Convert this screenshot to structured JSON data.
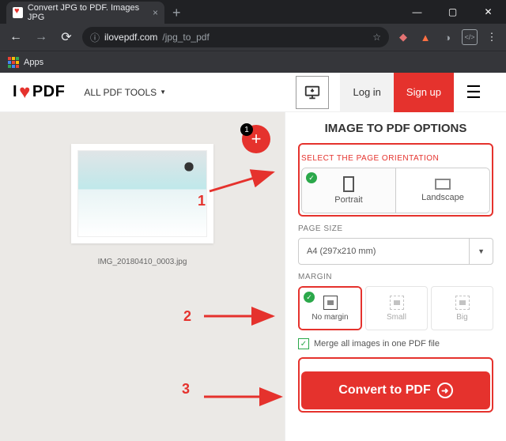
{
  "browser": {
    "tab_title": "Convert JPG to PDF. Images JPG",
    "url_domain": "ilovepdf.com",
    "url_path": "/jpg_to_pdf",
    "bookmarks_label": "Apps"
  },
  "header": {
    "logo_left": "I",
    "logo_right": "PDF",
    "nav_label": "ALL PDF TOOLS",
    "login": "Log in",
    "signup": "Sign up"
  },
  "preview": {
    "add_badge": "1",
    "file_name": "IMG_20180410_0003.jpg"
  },
  "options": {
    "title": "IMAGE TO PDF OPTIONS",
    "orientation": {
      "label": "SELECT THE PAGE ORIENTATION",
      "portrait": "Portrait",
      "landscape": "Landscape"
    },
    "page_size": {
      "label": "PAGE SIZE",
      "value": "A4 (297x210 mm)"
    },
    "margin": {
      "label": "MARGIN",
      "none": "No margin",
      "small": "Small",
      "big": "Big"
    },
    "merge_label": "Merge all images in one PDF file",
    "convert_label": "Convert to PDF"
  },
  "annotations": {
    "n1": "1",
    "n2": "2",
    "n3": "3"
  }
}
